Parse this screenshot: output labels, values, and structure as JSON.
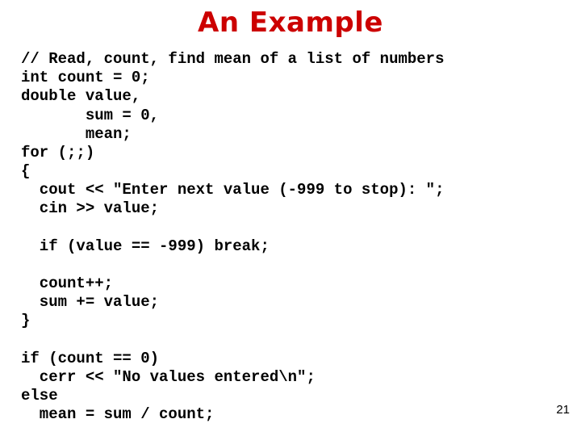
{
  "title": "An Example",
  "code": "// Read, count, find mean of a list of numbers\nint count = 0;\ndouble value,\n       sum = 0,\n       mean;\nfor (;;)\n{\n  cout << \"Enter next value (-999 to stop): \";\n  cin >> value;\n\n  if (value == -999) break;\n\n  count++;\n  sum += value;\n}\n\nif (count == 0)\n  cerr << \"No values entered\\n\";\nelse\n  mean = sum / count;",
  "page_number": "21"
}
